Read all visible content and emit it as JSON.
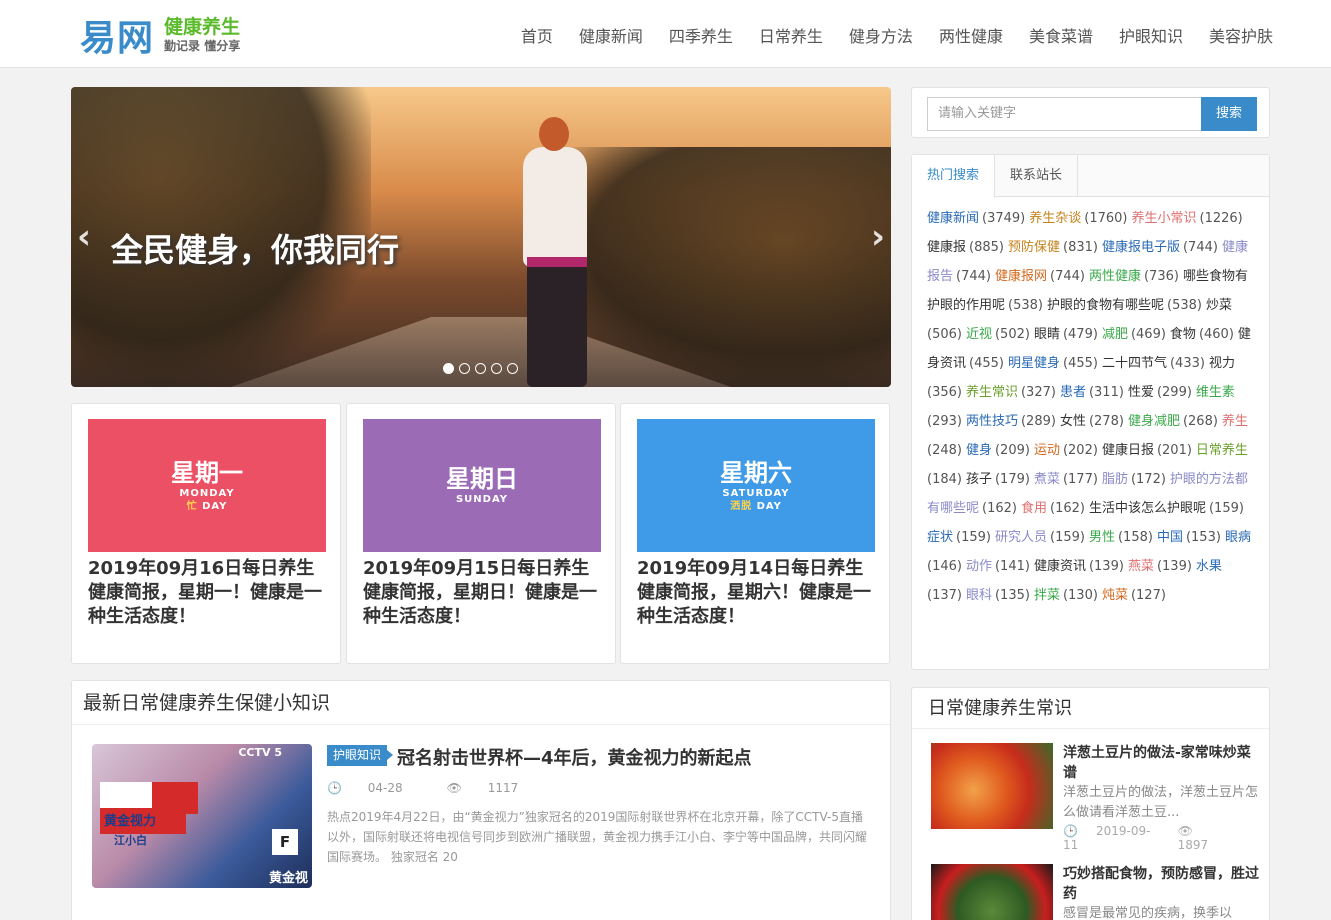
{
  "logo": {
    "main": "易网",
    "sub1": "健康养生",
    "sub2": "勤记录 懂分享"
  },
  "nav": [
    "首页",
    "健康新闻",
    "四季养生",
    "日常养生",
    "健身方法",
    "两性健康",
    "美食菜谱",
    "护眼知识",
    "美容护肤"
  ],
  "slider": {
    "caption": "全民健身，你我同行",
    "prev": "‹",
    "next": "›",
    "slides_total": 5,
    "slide_active": 1
  },
  "cards": [
    {
      "day_cn": "星期一",
      "day_en": "MONDAY",
      "day_en2_hl": "忙",
      "day_en2": "DAY",
      "color": "#ec5065",
      "title": "2019年09月16日每日养生健康简报，星期一！健康是一种生活态度！"
    },
    {
      "day_cn": "星期日",
      "day_en": "SUNDAY",
      "day_en2_hl": "",
      "day_en2": "",
      "color": "#9b6bb5",
      "title": "2019年09月15日每日养生健康简报，星期日！健康是一种生活态度！"
    },
    {
      "day_cn": "星期六",
      "day_en": "SATURDAY",
      "day_en2_hl": "洒脱",
      "day_en2": "DAY",
      "color": "#3f9ae8",
      "title": "2019年09月14日每日养生健康简报，星期六！健康是一种生活态度！"
    }
  ],
  "latest": {
    "heading": "最新日常健康养生保健小知识",
    "post": {
      "tag": "护眼知识",
      "title": "冠名射击世界杯—4年后，黄金视力的新起点",
      "date": "04-28",
      "views": "1117",
      "excerpt": "热点2019年4月22日，由“黄金视力”独家冠名的2019国际射联世界杯在北京开幕，除了CCTV-5直播以外，国际射联还将电视信号同步到欧洲广播联盟，黄金视力携手江小白、李宁等中国品牌，共同闪耀国际赛场。 独家冠名 20",
      "image_texts": {
        "cctv": "CCTV 5",
        "board": "黄金视力",
        "board2": "江小白",
        "letter": "F",
        "gold": "黄金视"
      }
    }
  },
  "search": {
    "placeholder": "请输入关键字",
    "button": "搜索"
  },
  "tabs": [
    "热门搜索",
    "联系站长"
  ],
  "tag_list": [
    {
      "name": "健康新闻",
      "count": "(3749)",
      "color": "#2a6ab5"
    },
    {
      "name": "养生杂谈",
      "count": "(1760)",
      "color": "#c4821a"
    },
    {
      "name": "养生小常识",
      "count": "(1226)",
      "color": "#e06e6e"
    },
    {
      "name": "健康报",
      "count": "(885)",
      "color": "#333333"
    },
    {
      "name": "预防保健",
      "count": "(831)",
      "color": "#c4821a"
    },
    {
      "name": "健康报电子版",
      "count": "(744)",
      "color": "#2a6ab5"
    },
    {
      "name": "健康报告",
      "count": "(744)",
      "color": "#8a8ac8"
    },
    {
      "name": "健康报网",
      "count": "(744)",
      "color": "#d2691e"
    },
    {
      "name": "两性健康",
      "count": "(736)",
      "color": "#3aa84a"
    },
    {
      "name": "哪些食物有护眼的作用呢",
      "count": "(538)",
      "color": "#333333"
    },
    {
      "name": "护眼的食物有哪些呢",
      "count": "(538)",
      "color": "#333333"
    },
    {
      "name": "炒菜",
      "count": "(506)",
      "color": "#333333"
    },
    {
      "name": "近视",
      "count": "(502)",
      "color": "#3aa84a"
    },
    {
      "name": "眼睛",
      "count": "(479)",
      "color": "#333333"
    },
    {
      "name": "减肥",
      "count": "(469)",
      "color": "#3aa84a"
    },
    {
      "name": "食物",
      "count": "(460)",
      "color": "#333333"
    },
    {
      "name": "健身资讯",
      "count": "(455)",
      "color": "#333333"
    },
    {
      "name": "明星健身",
      "count": "(455)",
      "color": "#2a6ab5"
    },
    {
      "name": "二十四节气",
      "count": "(433)",
      "color": "#333333"
    },
    {
      "name": "视力",
      "count": "(356)",
      "color": "#333333"
    },
    {
      "name": "养生常识",
      "count": "(327)",
      "color": "#6aa02a"
    },
    {
      "name": "患者",
      "count": "(311)",
      "color": "#2a6ab5"
    },
    {
      "name": "性爱",
      "count": "(299)",
      "color": "#333333"
    },
    {
      "name": "维生素",
      "count": "(293)",
      "color": "#3aa84a"
    },
    {
      "name": "两性技巧",
      "count": "(289)",
      "color": "#2a6ab5"
    },
    {
      "name": "女性",
      "count": "(278)",
      "color": "#333333"
    },
    {
      "name": "健身减肥",
      "count": "(268)",
      "color": "#3aa84a"
    },
    {
      "name": "养生",
      "count": "(248)",
      "color": "#e06e6e"
    },
    {
      "name": "健身",
      "count": "(209)",
      "color": "#2a6ab5"
    },
    {
      "name": "运动",
      "count": "(202)",
      "color": "#d2691e"
    },
    {
      "name": "健康日报",
      "count": "(201)",
      "color": "#333333"
    },
    {
      "name": "日常养生",
      "count": "(184)",
      "color": "#6aa02a"
    },
    {
      "name": "孩子",
      "count": "(179)",
      "color": "#333333"
    },
    {
      "name": "煮菜",
      "count": "(177)",
      "color": "#8a8ac8"
    },
    {
      "name": "脂肪",
      "count": "(172)",
      "color": "#8a8ac8"
    },
    {
      "name": "护眼的方法都有哪些呢",
      "count": "(162)",
      "color": "#8a8ac8"
    },
    {
      "name": "食用",
      "count": "(162)",
      "color": "#e06e6e"
    },
    {
      "name": "生活中该怎么护眼呢",
      "count": "(159)",
      "color": "#333333"
    },
    {
      "name": "症状",
      "count": "(159)",
      "color": "#2a6ab5"
    },
    {
      "name": "研究人员",
      "count": "(159)",
      "color": "#8a8ac8"
    },
    {
      "name": "男性",
      "count": "(158)",
      "color": "#3aa84a"
    },
    {
      "name": "中国",
      "count": "(153)",
      "color": "#2a6ab5"
    },
    {
      "name": "眼病",
      "count": "(146)",
      "color": "#2a6ab5"
    },
    {
      "name": "动作",
      "count": "(141)",
      "color": "#8a8ac8"
    },
    {
      "name": "健康资讯",
      "count": "(139)",
      "color": "#333333"
    },
    {
      "name": "燕菜",
      "count": "(139)",
      "color": "#e06e6e"
    },
    {
      "name": "水果",
      "count": "(137)",
      "color": "#2a6ab5"
    },
    {
      "name": "眼科",
      "count": "(135)",
      "color": "#8a8ac8"
    },
    {
      "name": "拌菜",
      "count": "(130)",
      "color": "#3aa84a"
    },
    {
      "name": "炖菜",
      "count": "(127)",
      "color": "#d2691e"
    }
  ],
  "daily": {
    "heading": "日常健康养生常识",
    "items": [
      {
        "title": "洋葱土豆片的做法-家常味炒菜谱",
        "desc": "洋葱土豆片的做法，洋葱土豆片怎么做请看洋葱土豆...",
        "date": "2019-09-11",
        "views": "1897"
      },
      {
        "title": "巧妙搭配食物，预防感冒，胜过药",
        "desc": "感冒是最常见的疾病，换季以",
        "date": "",
        "views": ""
      }
    ]
  }
}
